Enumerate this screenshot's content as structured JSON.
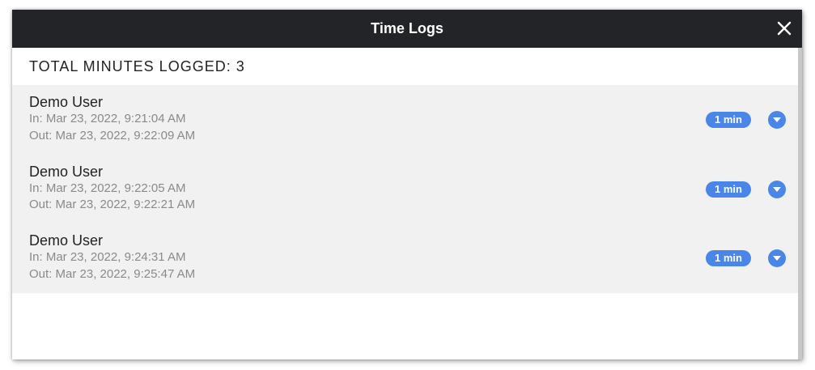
{
  "dialog": {
    "title": "Time Logs",
    "close_icon": "close-icon"
  },
  "summary": {
    "total_label": "TOTAL MINUTES LOGGED: 3"
  },
  "logs": [
    {
      "user": "Demo User",
      "in": "In: Mar 23, 2022, 9:21:04 AM",
      "out": "Out: Mar 23, 2022, 9:22:09 AM",
      "duration": "1 min"
    },
    {
      "user": "Demo User",
      "in": "In: Mar 23, 2022, 9:22:05 AM",
      "out": "Out: Mar 23, 2022, 9:22:21 AM",
      "duration": "1 min"
    },
    {
      "user": "Demo User",
      "in": "In: Mar 23, 2022, 9:24:31 AM",
      "out": "Out: Mar 23, 2022, 9:25:47 AM",
      "duration": "1 min"
    }
  ],
  "colors": {
    "header_bg": "#232427",
    "accent": "#4a86e8",
    "row_bg": "#f1f1f1"
  }
}
